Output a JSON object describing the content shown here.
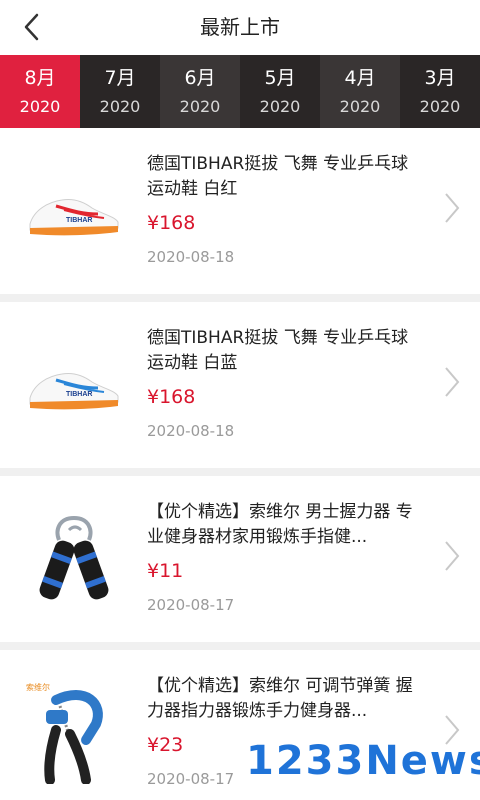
{
  "header": {
    "title": "最新上市",
    "back_icon": "chevron-left-icon"
  },
  "months": [
    {
      "month": "8月",
      "year": "2020",
      "active": true
    },
    {
      "month": "7月",
      "year": "2020",
      "active": false
    },
    {
      "month": "6月",
      "year": "2020",
      "active": false
    },
    {
      "month": "5月",
      "year": "2020",
      "active": false
    },
    {
      "month": "4月",
      "year": "2020",
      "active": false
    },
    {
      "month": "3月",
      "year": "2020",
      "active": false
    }
  ],
  "products": [
    {
      "title": "德国TIBHAR挺拔 飞舞 专业乒乓球运动鞋 白红",
      "price": "¥168",
      "date": "2020-08-18",
      "image": "table-tennis-shoe-red"
    },
    {
      "title": "德国TIBHAR挺拔 飞舞 专业乒乓球运动鞋 白蓝",
      "price": "¥168",
      "date": "2020-08-18",
      "image": "table-tennis-shoe-blue"
    },
    {
      "title": "【优个精选】索维尔 男士握力器 专业健身器材家用锻炼手指健...",
      "price": "¥11",
      "date": "2020-08-17",
      "image": "hand-grip-black-blue"
    },
    {
      "title": "【优个精选】索维尔 可调节弹簧 握力器指力器锻炼手力健身器...",
      "price": "¥23",
      "date": "2020-08-17",
      "image": "adjustable-hand-grip"
    }
  ],
  "colors": {
    "accent": "#e0213f",
    "price": "#d9152d",
    "tab_bg": "#2a2626"
  },
  "watermark": "1233News"
}
